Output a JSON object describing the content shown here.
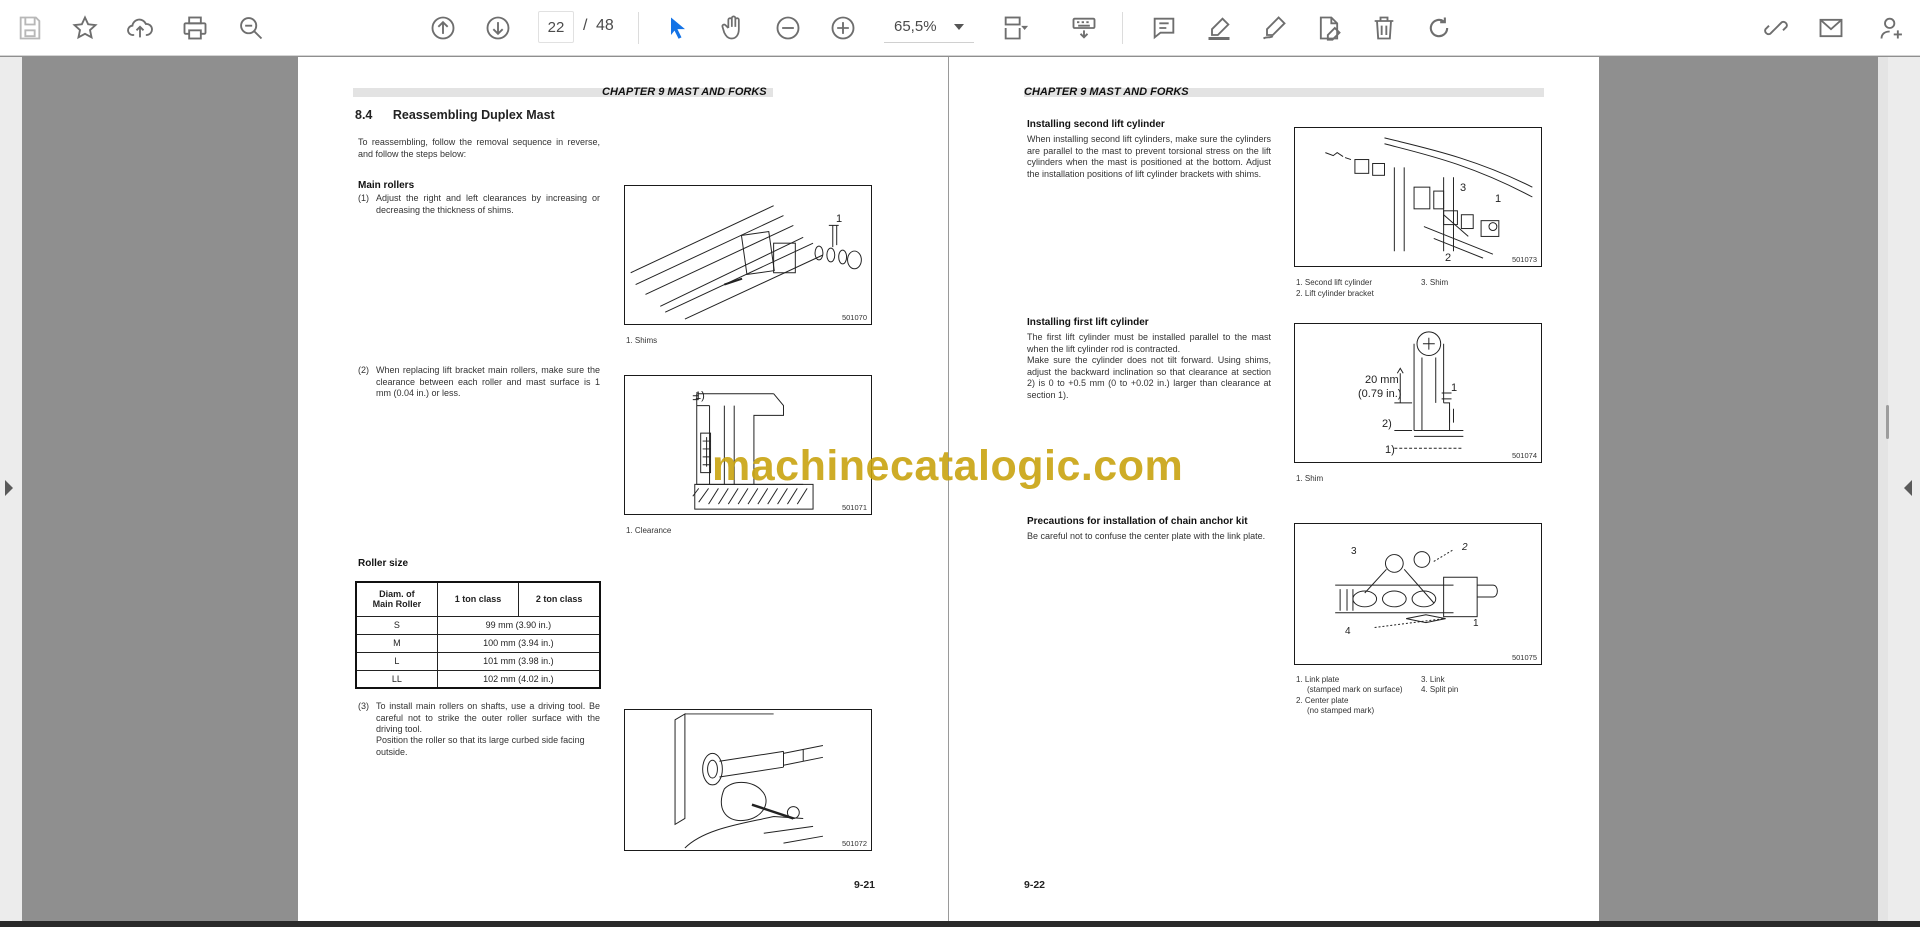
{
  "toolbar": {
    "icons": [
      "save-icon",
      "star-icon",
      "upload-icon",
      "print-icon",
      "zoom-out-search-icon",
      "arrow-up-icon",
      "arrow-down-icon",
      "select-cursor-icon",
      "hand-icon",
      "minus-icon",
      "plus-icon",
      "crop-icon",
      "keyboard-icon",
      "comment-icon",
      "highlight-icon",
      "draw-icon",
      "edit-icon",
      "delete-icon",
      "redo-icon",
      "link-icon",
      "mail-icon",
      "add-user-icon"
    ],
    "page_current": "22",
    "page_separator": "/",
    "page_total": "48",
    "zoom": "65,5%"
  },
  "left_page": {
    "chapter": "CHAPTER 9 MAST AND FORKS",
    "section_number": "8.4",
    "section_title": "Reassembling Duplex Mast",
    "intro": "To reassembling, follow the removal sequence in reverse, and follow the steps below:",
    "main_rollers_heading": "Main rollers",
    "step1_num": "(1)",
    "step1": "Adjust the right and left clearances by increasing or decreasing the thickness of shims.",
    "fig1_id": "501070",
    "fig1_label": "1",
    "fig1_caption": "1.  Shims",
    "step2_num": "(2)",
    "step2": "When replacing lift bracket main rollers, make sure the clearance between each roller and mast surface is 1 mm (0.04 in.) or less.",
    "fig2_id": "501071",
    "fig2_label": "1)",
    "fig2_caption": "1.  Clearance",
    "roller_size_heading": "Roller size",
    "table": {
      "headers": [
        "Diam. of",
        "Main Roller",
        "1 ton class",
        "2 ton class"
      ],
      "rows": [
        {
          "size": "S",
          "value": "99 mm (3.90 in.)"
        },
        {
          "size": "M",
          "value": "100 mm (3.94 in.)"
        },
        {
          "size": "L",
          "value": "101 mm (3.98 in.)"
        },
        {
          "size": "LL",
          "value": "102 mm (4.02 in.)"
        }
      ]
    },
    "step3_num": "(3)",
    "step3": "To install main rollers on shafts, use a driving tool. Be careful not to strike the outer roller surface with the driving tool.",
    "step3b": "Position the roller so that its large curbed side facing outside.",
    "fig3_id": "501072",
    "page_number": "9-21"
  },
  "right_page": {
    "chapter": "CHAPTER 9 MAST AND FORKS",
    "second_cyl_heading": "Installing second lift cylinder",
    "second_cyl_text": "When installing second lift cylinders, make sure the cylinders are parallel to the mast to prevent torsional stress on the lift cylinders when the mast is positioned at the bottom. Adjust the installation positions of lift cylinder brackets with shims.",
    "fig4_id": "501073",
    "fig4_labels": [
      "3",
      "1",
      "2"
    ],
    "fig4_caption_1": "1.  Second lift cylinder",
    "fig4_caption_2": "2.  Lift cylinder bracket",
    "fig4_caption_3": "3.  Shim",
    "first_cyl_heading": "Installing first lift cylinder",
    "first_cyl_text_1": "The first lift cylinder must be installed parallel to the mast when the lift cylinder rod is contracted.",
    "first_cyl_text_2": "Make sure the cylinder does not tilt forward. Using shims, adjust the backward inclination so that clearance at section 2) is 0 to +0.5 mm (0 to +0.02 in.) larger than clearance at section 1).",
    "fig5_id": "501074",
    "fig5_dim_1": "20 mm",
    "fig5_dim_2": "(0.79 in.)",
    "fig5_label_1": "1",
    "fig5_label_2": "2)",
    "fig5_label_3": "1)",
    "fig5_caption": "1.  Shim",
    "chain_heading": "Precautions for installation of chain anchor kit",
    "chain_text": "Be careful not to confuse the center plate with the link plate.",
    "fig6_id": "501075",
    "fig6_labels": [
      "3",
      "2",
      "4",
      "1"
    ],
    "fig6_caption_1": "1.  Link plate",
    "fig6_caption_1b": "(stamped mark on surface)",
    "fig6_caption_2": "2.  Center plate",
    "fig6_caption_2b": "(no stamped mark)",
    "fig6_caption_3": "3.  Link",
    "fig6_caption_4": "4.  Split pin",
    "page_number": "9-22"
  },
  "watermark": "machinecatalogic.com"
}
